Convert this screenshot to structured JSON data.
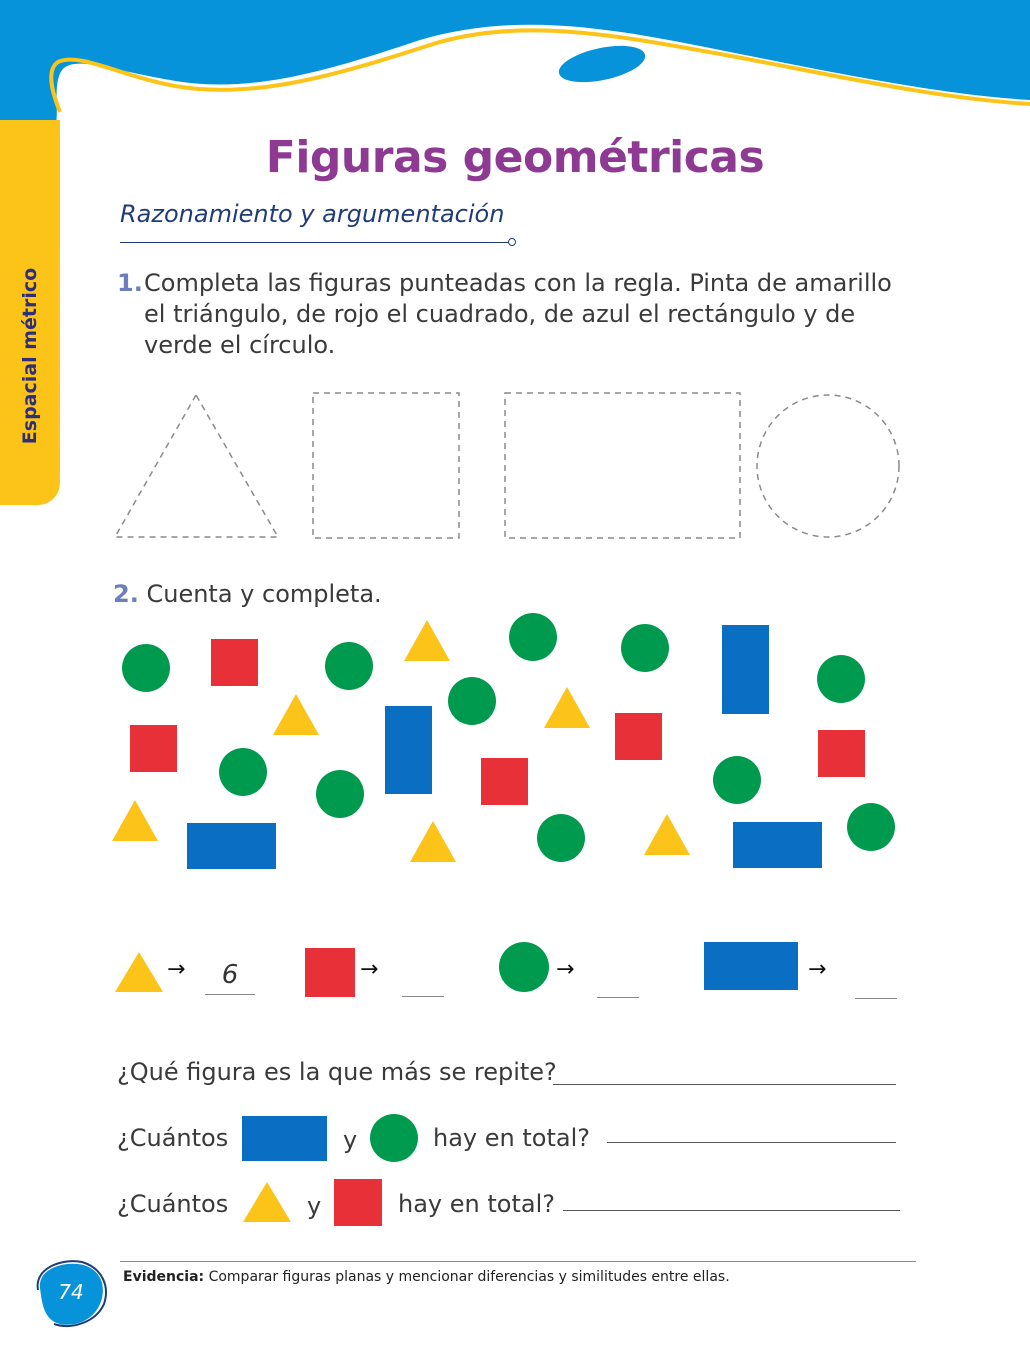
{
  "side_tab": {
    "label": "Espacial métrico"
  },
  "title": "Figuras geométricas",
  "section": {
    "heading": "Razonamiento y argumentación"
  },
  "question1": {
    "number": "1.",
    "text": "Completa las figuras punteadas con la regla. Pinta de amarillo el triángulo, de rojo el cuadrado, de azul el rectángulo y de verde el círculo."
  },
  "question2": {
    "number": "2.",
    "text": "Cuenta y completa.",
    "counts": [
      {
        "shape": "triangle",
        "value": "6"
      },
      {
        "shape": "square",
        "value": ""
      },
      {
        "shape": "circle",
        "value": ""
      },
      {
        "shape": "rectangle",
        "value": ""
      }
    ],
    "arrow": "→"
  },
  "questions": {
    "most_repeated": "¿Qué figura es la que más se repite?",
    "total_1_prefix": "¿Cuántos",
    "total_1_and": "y",
    "total_1_suffix": "hay en total?",
    "total_2_prefix": "¿Cuántos",
    "total_2_and": "y",
    "total_2_suffix": "hay en total?"
  },
  "footer": {
    "evidence_label": "Evidencia:",
    "evidence_text": " Comparar figuras planas y mencionar diferencias y similitudes entre ellas.",
    "page_number": "74"
  },
  "colors": {
    "blue": "#0a6fc2",
    "red": "#e83038",
    "green": "#009a4e",
    "yellow": "#fcc419",
    "title_purple": "#8e3a93",
    "header_blue": "#0693d9"
  }
}
